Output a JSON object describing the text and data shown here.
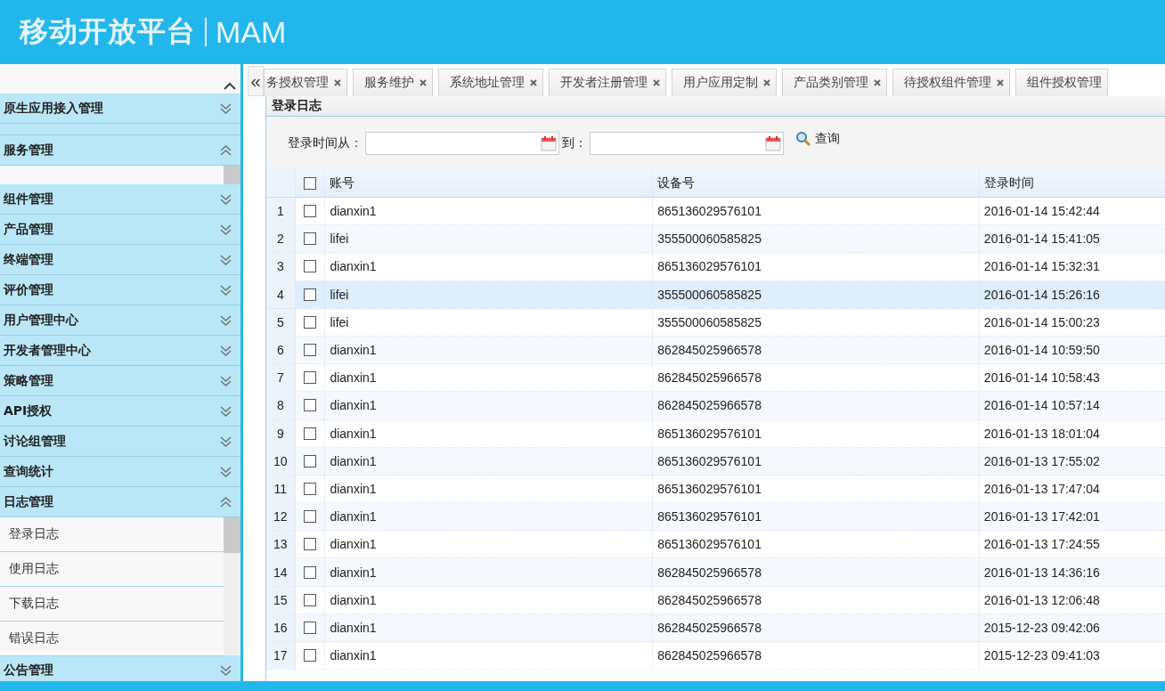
{
  "header": {
    "logo": "移动开放平台",
    "product": "MAM"
  },
  "sidebar": {
    "sections": [
      {
        "title": "原生应用接入管理",
        "expanded": false
      },
      {
        "title": "服务管理",
        "expanded": true
      },
      {
        "title": "组件管理",
        "expanded": false
      },
      {
        "title": "产品管理",
        "expanded": false
      },
      {
        "title": "终端管理",
        "expanded": false
      },
      {
        "title": "评价管理",
        "expanded": false
      },
      {
        "title": "用户管理中心",
        "expanded": false
      },
      {
        "title": "开发者管理中心",
        "expanded": false
      },
      {
        "title": "策略管理",
        "expanded": false
      },
      {
        "title": "API授权",
        "expanded": false
      },
      {
        "title": "讨论组管理",
        "expanded": false
      },
      {
        "title": "查询统计",
        "expanded": false
      },
      {
        "title": "日志管理",
        "expanded": true,
        "items": [
          "登录日志",
          "使用日志",
          "下载日志",
          "错误日志"
        ]
      },
      {
        "title": "公告管理",
        "expanded": false
      }
    ]
  },
  "collapse_button": "«",
  "tabs": [
    {
      "label": "务授权管理",
      "closable": true
    },
    {
      "label": "服务维护",
      "closable": true
    },
    {
      "label": "系统地址管理",
      "closable": true
    },
    {
      "label": "开发者注册管理",
      "closable": true
    },
    {
      "label": "用户应用定制",
      "closable": true
    },
    {
      "label": "产品类别管理",
      "closable": true
    },
    {
      "label": "待授权组件管理",
      "closable": true
    },
    {
      "label": "组件授权管理",
      "closable": false
    }
  ],
  "panel": {
    "title": "登录日志"
  },
  "filter": {
    "from_label": "登录时间从：",
    "to_label": "到：",
    "search_button": "查询"
  },
  "table": {
    "columns": [
      "账号",
      "设备号",
      "登录时间"
    ],
    "all_checked": false,
    "rows": [
      {
        "num": "1",
        "checked": false,
        "account": "dianxin1",
        "device": "865136029576101",
        "time": "2016-01-14 15:42:44",
        "highlighted": false
      },
      {
        "num": "2",
        "checked": false,
        "account": "lifei",
        "device": "355500060585825",
        "time": "2016-01-14 15:41:05",
        "highlighted": false
      },
      {
        "num": "3",
        "checked": false,
        "account": "dianxin1",
        "device": "865136029576101",
        "time": "2016-01-14 15:32:31",
        "highlighted": false
      },
      {
        "num": "4",
        "checked": false,
        "account": "lifei",
        "device": "355500060585825",
        "time": "2016-01-14 15:26:16",
        "highlighted": true
      },
      {
        "num": "5",
        "checked": false,
        "account": "lifei",
        "device": "355500060585825",
        "time": "2016-01-14 15:00:23",
        "highlighted": false
      },
      {
        "num": "6",
        "checked": false,
        "account": "dianxin1",
        "device": "862845025966578",
        "time": "2016-01-14 10:59:50",
        "highlighted": false
      },
      {
        "num": "7",
        "checked": false,
        "account": "dianxin1",
        "device": "862845025966578",
        "time": "2016-01-14 10:58:43",
        "highlighted": false
      },
      {
        "num": "8",
        "checked": false,
        "account": "dianxin1",
        "device": "862845025966578",
        "time": "2016-01-14 10:57:14",
        "highlighted": false
      },
      {
        "num": "9",
        "checked": false,
        "account": "dianxin1",
        "device": "865136029576101",
        "time": "2016-01-13 18:01:04",
        "highlighted": false
      },
      {
        "num": "10",
        "checked": false,
        "account": "dianxin1",
        "device": "865136029576101",
        "time": "2016-01-13 17:55:02",
        "highlighted": false
      },
      {
        "num": "11",
        "checked": false,
        "account": "dianxin1",
        "device": "865136029576101",
        "time": "2016-01-13 17:47:04",
        "highlighted": false
      },
      {
        "num": "12",
        "checked": false,
        "account": "dianxin1",
        "device": "865136029576101",
        "time": "2016-01-13 17:42:01",
        "highlighted": false
      },
      {
        "num": "13",
        "checked": false,
        "account": "dianxin1",
        "device": "865136029576101",
        "time": "2016-01-13 17:24:55",
        "highlighted": false
      },
      {
        "num": "14",
        "checked": false,
        "account": "dianxin1",
        "device": "862845025966578",
        "time": "2016-01-13 14:36:16",
        "highlighted": false
      },
      {
        "num": "15",
        "checked": false,
        "account": "dianxin1",
        "device": "862845025966578",
        "time": "2016-01-13 12:06:48",
        "highlighted": false
      },
      {
        "num": "16",
        "checked": false,
        "account": "dianxin1",
        "device": "862845025966578",
        "time": "2015-12-23 09:42:06",
        "highlighted": false
      },
      {
        "num": "17",
        "checked": false,
        "account": "dianxin1",
        "device": "862845025966578",
        "time": "2015-12-23 09:41:03",
        "highlighted": false
      }
    ]
  }
}
